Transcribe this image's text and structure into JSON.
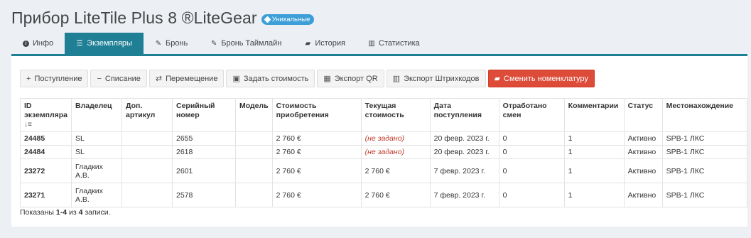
{
  "page": {
    "title": "Прибор LiteTile Plus 8 ®LiteGear",
    "badge": "Уникальные"
  },
  "tabs": [
    {
      "label": "Инфо",
      "icon": "info-circle-icon"
    },
    {
      "label": "Экземпляры",
      "icon": "list-icon",
      "active": true
    },
    {
      "label": "Бронь",
      "icon": "gavel-icon"
    },
    {
      "label": "Бронь Таймлайн",
      "icon": "gavel-icon"
    },
    {
      "label": "История",
      "icon": "book-icon"
    },
    {
      "label": "Статистика",
      "icon": "bar-chart-icon"
    }
  ],
  "toolbar": {
    "receipt": "Поступление",
    "writeoff": "Списание",
    "move": "Перемещение",
    "set_cost": "Задать стоимость",
    "export_qr": "Экспорт QR",
    "export_barcodes": "Экспорт Штрихкодов",
    "change_nomenclature": "Сменить номенклатуру"
  },
  "table": {
    "headers": {
      "id": "ID экземпляра",
      "owner": "Владелец",
      "extra_article": "Доп. артикул",
      "serial": "Серийный номер",
      "model": "Модель",
      "purchase_cost": "Стоимость приобретения",
      "current_cost": "Текущая стоимость",
      "arrival_date": "Дата поступления",
      "shifts": "Отработано смен",
      "comments": "Комментарии",
      "status": "Статус",
      "location": "Местонахождение"
    },
    "rows": [
      {
        "id": "24485",
        "owner": "SL",
        "extra_article": "",
        "serial": "2655",
        "model": "",
        "purchase_cost": "2 760 €",
        "current_cost": "(не задано)",
        "arrival_date": "20 февр. 2023 г.",
        "shifts": "0",
        "comments": "1",
        "status": "Активно",
        "location": "SPB-1 ЛКС"
      },
      {
        "id": "24484",
        "owner": "SL",
        "extra_article": "",
        "serial": "2618",
        "model": "",
        "purchase_cost": "2 760 €",
        "current_cost": "(не задано)",
        "arrival_date": "20 февр. 2023 г.",
        "shifts": "0",
        "comments": "1",
        "status": "Активно",
        "location": "SPB-1 ЛКС"
      },
      {
        "id": "23272",
        "owner": "Гладких А.В.",
        "extra_article": "",
        "serial": "2601",
        "model": "",
        "purchase_cost": "2 760 €",
        "current_cost": "2 760 €",
        "arrival_date": "7 февр. 2023 г.",
        "shifts": "0",
        "comments": "1",
        "status": "Активно",
        "location": "SPB-1 ЛКС"
      },
      {
        "id": "23271",
        "owner": "Гладких А.В.",
        "extra_article": "",
        "serial": "2578",
        "model": "",
        "purchase_cost": "2 760 €",
        "current_cost": "2 760 €",
        "arrival_date": "7 февр. 2023 г.",
        "shifts": "0",
        "comments": "1",
        "status": "Активно",
        "location": "SPB-1 ЛКС"
      }
    ]
  },
  "footer": {
    "prefix": "Показаны",
    "range": "1-4",
    "middle": "из",
    "total": "4",
    "suffix": "записи."
  }
}
